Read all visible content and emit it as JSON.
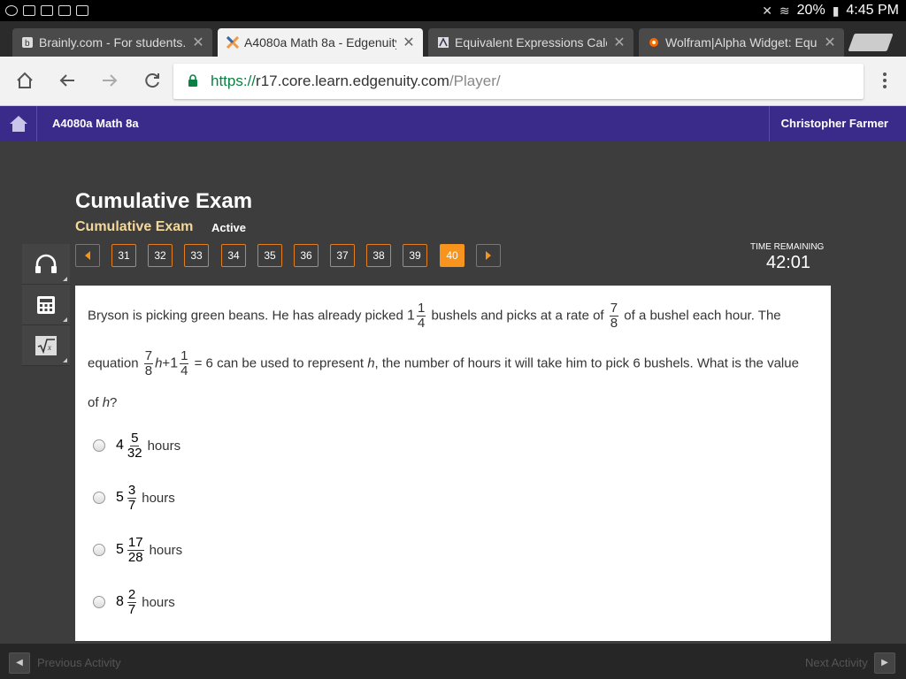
{
  "status_bar": {
    "battery": "20%",
    "time": "4:45 PM"
  },
  "tabs": [
    {
      "label": "Brainly.com - For students. F",
      "icon": "brainly-icon"
    },
    {
      "label": "A4080a Math 8a - Edgenuity",
      "icon": "edgenuity-icon",
      "active": true
    },
    {
      "label": "Equivalent Expressions Calc",
      "icon": "calculator-site-icon"
    },
    {
      "label": "Wolfram|Alpha Widget: Equi",
      "icon": "wolfram-icon"
    }
  ],
  "address_bar": {
    "scheme": "https://",
    "host": "r17.core.learn.edgenuity.com",
    "path": "/Player/"
  },
  "app": {
    "course_title": "A4080a Math 8a",
    "user_name": "Christopher Farmer"
  },
  "exam": {
    "title": "Cumulative Exam",
    "subtitle": "Cumulative Exam",
    "status": "Active"
  },
  "question_nav": {
    "numbers": [
      "31",
      "32",
      "33",
      "34",
      "35",
      "36",
      "37",
      "38",
      "39",
      "40"
    ],
    "current": "40"
  },
  "timer": {
    "label": "TIME REMAINING",
    "value": "42:01"
  },
  "question": {
    "part1": "Bryson is picking green beans. He has already picked",
    "mixed1_whole": "1",
    "mixed1_num": "1",
    "mixed1_den": "4",
    "part2": "bushels and picks at a rate of",
    "rate_num": "7",
    "rate_den": "8",
    "part3": "of a bushel each hour. The",
    "part4": "equation",
    "eq_num": "7",
    "eq_den": "8",
    "eq_var": "h",
    "eq_plus": "+",
    "eq_whole": "1",
    "eq_mnum": "1",
    "eq_mden": "4",
    "eq_rhs": "= 6",
    "part5": "can be used to represent",
    "part5_var": "h",
    "part6": ", the number of hours it will take him to pick 6 bushels. What is the value",
    "part7": "of",
    "part7_var": "h",
    "part7_end": "?"
  },
  "choices": [
    {
      "whole": "4",
      "num": "5",
      "den": "32",
      "unit": "hours"
    },
    {
      "whole": "5",
      "num": "3",
      "den": "7",
      "unit": "hours"
    },
    {
      "whole": "5",
      "num": "17",
      "den": "28",
      "unit": "hours"
    },
    {
      "whole": "8",
      "num": "2",
      "den": "7",
      "unit": "hours"
    }
  ],
  "footer": {
    "prev_label": "Previous Activity",
    "next_label": "Next Activity"
  },
  "colors": {
    "nav_purple": "#3a2a8a",
    "accent_orange": "#f7941d",
    "subtitle_gold": "#f4d89a"
  }
}
